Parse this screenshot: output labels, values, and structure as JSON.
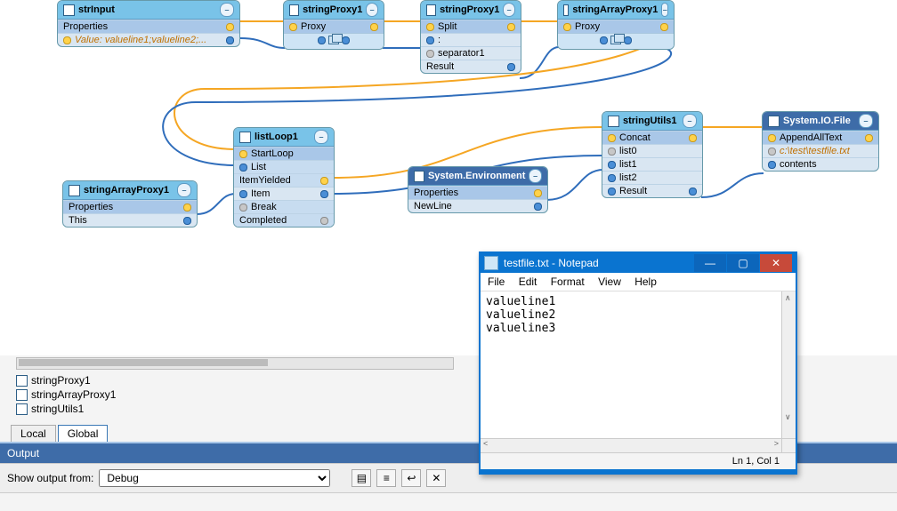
{
  "canvas": {
    "nodes": {
      "strInput": {
        "title": "strInput",
        "sub": "Properties",
        "value": "Value: valueline1;valueline2;..."
      },
      "stringProxy1a": {
        "title": "stringProxy1",
        "sub": "Proxy"
      },
      "stringProxy1b": {
        "title": "stringProxy1",
        "sub": "Split",
        "rows": [
          ":",
          "separator1",
          "Result"
        ]
      },
      "stringArrayProxy1a": {
        "title": "stringArrayProxy1",
        "sub": "Proxy"
      },
      "stringArrayProxy1b": {
        "title": "stringArrayProxy1",
        "sub": "Properties",
        "rows": [
          "This"
        ]
      },
      "listLoop1": {
        "title": "listLoop1",
        "rows": [
          "StartLoop",
          "List",
          "ItemYielded",
          "Item",
          "Break",
          "Completed"
        ]
      },
      "sysEnv": {
        "title": "System.Environment",
        "sub": "Properties",
        "rows": [
          "NewLine"
        ]
      },
      "stringUtils1": {
        "title": "stringUtils1",
        "sub": "Concat",
        "rows": [
          "list0",
          "list1",
          "list2",
          "Result"
        ]
      },
      "sysIOFile": {
        "title": "System.IO.File",
        "sub": "AppendAllText",
        "path": "c:\\test\\testfile.txt",
        "rows": [
          "contents"
        ]
      }
    }
  },
  "sideList": [
    "stringProxy1",
    "stringArrayProxy1",
    "stringUtils1"
  ],
  "tabs": {
    "local": "Local",
    "global": "Global"
  },
  "output": {
    "title": "Output",
    "label": "Show output from:",
    "options": [
      "Debug"
    ],
    "selected": "Debug"
  },
  "notepad": {
    "title": "testfile.txt - Notepad",
    "menu": [
      "File",
      "Edit",
      "Format",
      "View",
      "Help"
    ],
    "content": "valueline1\nvalueline2\nvalueline3",
    "status": "Ln 1, Col 1"
  }
}
